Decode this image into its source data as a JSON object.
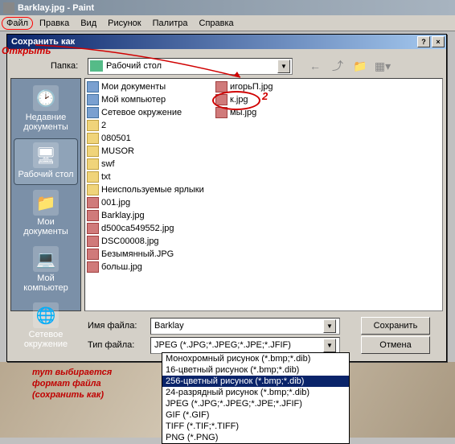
{
  "app": {
    "title": "Barklay.jpg - Paint"
  },
  "menu": {
    "file": "Файл",
    "edit": "Правка",
    "view": "Вид",
    "image": "Рисунок",
    "palette": "Палитра",
    "help": "Справка"
  },
  "dialog": {
    "title": "Сохранить как",
    "help_btn": "?",
    "close_btn": "×",
    "folder_label": "Папка:",
    "folder_value": "Рабочий стол",
    "filename_label": "Имя файла:",
    "filename_value": "Barklay",
    "filetype_label": "Тип файла:",
    "filetype_value": "JPEG (*.JPG;*.JPEG;*.JPE;*.JFIF)",
    "save_btn": "Сохранить",
    "cancel_btn": "Отмена"
  },
  "sidebar": {
    "items": [
      {
        "label": "Недавние документы"
      },
      {
        "label": "Рабочий стол"
      },
      {
        "label": "Мои документы"
      },
      {
        "label": "Мой компьютер"
      },
      {
        "label": "Сетевое окружение"
      }
    ]
  },
  "files_col1": [
    {
      "name": "Мои документы",
      "type": "folder-sys"
    },
    {
      "name": "Мой компьютер",
      "type": "folder-sys"
    },
    {
      "name": "Сетевое окружение",
      "type": "folder-sys"
    },
    {
      "name": "2",
      "type": "folder"
    },
    {
      "name": "080501",
      "type": "folder"
    },
    {
      "name": "MUSOR",
      "type": "folder"
    },
    {
      "name": "swf",
      "type": "folder"
    },
    {
      "name": "txt",
      "type": "folder"
    },
    {
      "name": "Неиспользуемые ярлыки",
      "type": "folder"
    },
    {
      "name": "001.jpg",
      "type": "jpg"
    },
    {
      "name": "Barklay.jpg",
      "type": "jpg"
    },
    {
      "name": "d500ca549552.jpg",
      "type": "jpg"
    },
    {
      "name": "DSC00008.jpg",
      "type": "jpg"
    },
    {
      "name": "Безымянный.JPG",
      "type": "jpg"
    },
    {
      "name": "больш.jpg",
      "type": "jpg"
    }
  ],
  "files_col2": [
    {
      "name": "игорьП.jpg",
      "type": "jpg"
    },
    {
      "name": "к.jpg",
      "type": "jpg",
      "ring": true
    },
    {
      "name": "мы.jpg",
      "type": "jpg"
    }
  ],
  "filetype_options": [
    "Монохромный рисунок (*.bmp;*.dib)",
    "16-цветный рисунок (*.bmp;*.dib)",
    "256-цветный рисунок (*.bmp;*.dib)",
    "24-разрядный рисунок (*.bmp;*.dib)",
    "JPEG (*.JPG;*.JPEG;*.JPE;*.JFIF)",
    "GIF (*.GIF)",
    "TIFF (*.TIF;*.TIFF)",
    "PNG (*.PNG)"
  ],
  "filetype_selected_index": 2,
  "annotations": {
    "open": "Открыть",
    "two": "2",
    "bottom_l1": "тут выбирается",
    "bottom_l2": "формат файла",
    "bottom_l3": "(сохранить как)"
  }
}
